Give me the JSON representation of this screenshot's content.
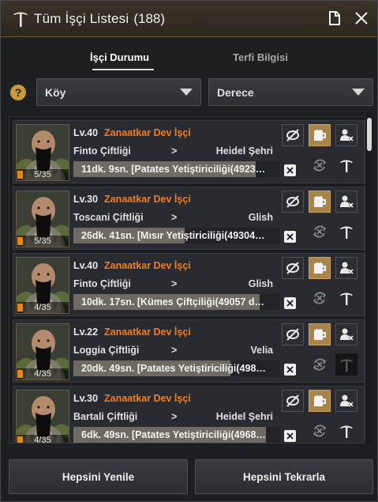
{
  "window": {
    "title": "Tüm İşçi Listesi",
    "count": "(188)"
  },
  "tabs": [
    {
      "label": "İşçi Durumu",
      "active": true
    },
    {
      "label": "Terfi Bilgisi",
      "active": false
    }
  ],
  "filters": {
    "location": "Köy",
    "grade": "Derece"
  },
  "workers": [
    {
      "stamina": "5/35",
      "level": "Lv.40",
      "job": "Zanaatkar Dev İşçi",
      "from": "Finto Çiftliği",
      "arrow": ">",
      "to": "Heidel Şehri",
      "task": "11dk. 9sn. [Patates Yetiştiriciliği(4923…",
      "progress_pct": 88
    },
    {
      "stamina": "5/35",
      "level": "Lv.30",
      "job": "Zanaatkar Dev İşçi",
      "from": "Toscani Çiftliği",
      "arrow": ">",
      "to": "Glish",
      "task": "26dk. 41sn. [Mısır Yetiştiriciliği(49304…",
      "progress_pct": 54
    },
    {
      "stamina": "4/35",
      "level": "Lv.40",
      "job": "Zanaatkar Dev İşçi",
      "from": "Finto Çiftliği",
      "arrow": ">",
      "to": "Glish",
      "task": "10dk. 17sn. [Kümes Çiftçiliği(49057 d…",
      "progress_pct": 90
    },
    {
      "stamina": "4/35",
      "level": "Lv.22",
      "job": "Zanaatkar Dev İşçi",
      "from": "Loggia Çiftliği",
      "arrow": ">",
      "to": "Velia",
      "task": "20dk. 49sn. [Patates Yetiştiriciliği(498…",
      "progress_pct": 76
    },
    {
      "stamina": "4/35",
      "level": "Lv.30",
      "job": "Zanaatkar Dev İşçi",
      "from": "Bartali Çiftliği",
      "arrow": ">",
      "to": "Heidel Şehri",
      "task": "6dk. 49sn. [Patates Yetiştiriciliği(4968…",
      "progress_pct": 93
    }
  ],
  "footer": {
    "refresh_all": "Hepsini Yenile",
    "repeat_all": "Hepsini Tekrarla"
  },
  "colors": {
    "accent_orange": "#f07d22",
    "gold_button": "#a8834a",
    "help_icon": "#c79a3a"
  },
  "icons": [
    "pickaxe-logo-icon",
    "document-icon",
    "close-icon",
    "help-icon",
    "caret-down-icon",
    "recover-stamina-icon",
    "beer-icon",
    "fire-worker-icon",
    "repeat-icon",
    "promote-icon",
    "cancel-task-icon"
  ]
}
